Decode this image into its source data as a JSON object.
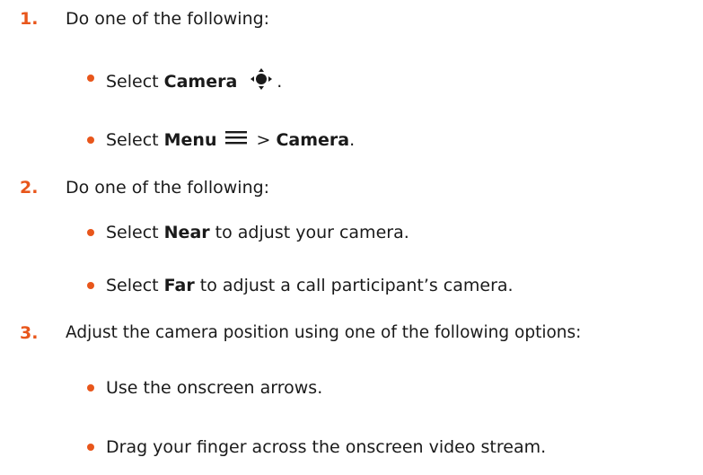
{
  "colors": {
    "accent": "#e8561b",
    "text": "#1a1a1a"
  },
  "steps": [
    {
      "number": "1.",
      "text": "Do one of the following:",
      "bullets": [
        {
          "prefix": "Select ",
          "bold": "Camera",
          "icon": "camera-control-icon",
          "suffix": "."
        },
        {
          "prefix": "Select ",
          "bold": "Menu",
          "icon": "menu-icon",
          "middle": " > ",
          "bold2": "Camera",
          "suffix": "."
        }
      ]
    },
    {
      "number": "2.",
      "text": "Do one of the following:",
      "bullets": [
        {
          "prefix": "Select ",
          "bold": "Near",
          "suffix": " to adjust your camera."
        },
        {
          "prefix": "Select ",
          "bold": "Far",
          "suffix": " to adjust a call participant’s camera."
        }
      ]
    },
    {
      "number": "3.",
      "text": "Adjust the camera position using one of the following options:",
      "bullets": [
        {
          "text": "Use the onscreen arrows."
        },
        {
          "text": "Drag your finger across the onscreen video stream."
        }
      ]
    }
  ]
}
